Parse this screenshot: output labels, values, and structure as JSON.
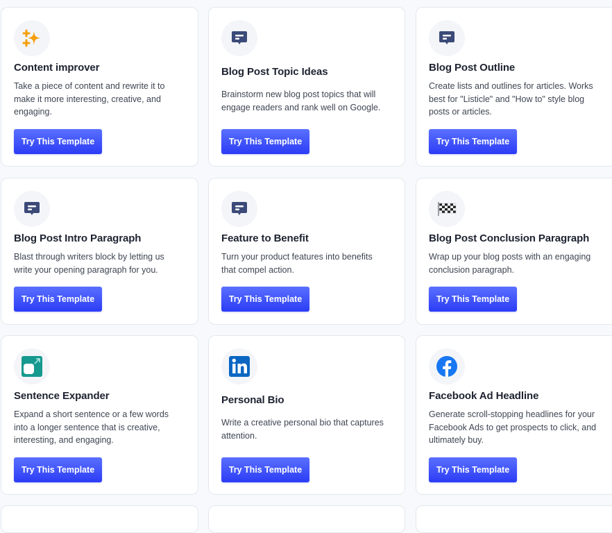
{
  "templates": [
    {
      "title": "Content improver",
      "description": "Take a piece of content and rewrite it to make it more interesting, creative, and engaging.",
      "icon": "sparkles-icon",
      "button_label": "Try This Template"
    },
    {
      "title": "Blog Post Topic Ideas",
      "description": "Brainstorm new blog post topics that will engage readers and rank well on Google.",
      "icon": "message-icon",
      "button_label": "Try This Template"
    },
    {
      "title": "Blog Post Outline",
      "description": "Create lists and outlines for articles. Works best for \"Listicle\" and \"How to\" style blog posts or articles.",
      "icon": "message-icon",
      "button_label": "Try This Template"
    },
    {
      "title": "Blog Post Intro Paragraph",
      "description": "Blast through writers block by letting us write your opening paragraph for you.",
      "icon": "message-icon",
      "button_label": "Try This Template"
    },
    {
      "title": "Feature to Benefit",
      "description": "Turn your product features into benefits that compel action.",
      "icon": "message-icon",
      "button_label": "Try This Template"
    },
    {
      "title": "Blog Post Conclusion Paragraph",
      "description": "Wrap up your blog posts with an engaging conclusion paragraph.",
      "icon": "checkered-flag-icon",
      "button_label": "Try This Template"
    },
    {
      "title": "Sentence Expander",
      "description": "Expand a short sentence or a few words into a longer sentence that is creative, interesting, and engaging.",
      "icon": "expand-icon",
      "button_label": "Try This Template"
    },
    {
      "title": "Personal Bio",
      "description": "Write a creative personal bio that captures attention.",
      "icon": "linkedin-icon",
      "button_label": "Try This Template"
    },
    {
      "title": "Facebook Ad Headline",
      "description": "Generate scroll-stopping headlines for your Facebook Ads to get prospects to click, and ultimately buy.",
      "icon": "facebook-icon",
      "button_label": "Try This Template"
    }
  ],
  "colors": {
    "button_gradient_top": "#5a70ff",
    "button_gradient_bottom": "#2b3cf5",
    "sparkle": "#f59e0b",
    "message": "#3b4a78",
    "expand": "#16998f",
    "linkedin": "#0a66c2",
    "facebook": "#1877f2"
  }
}
